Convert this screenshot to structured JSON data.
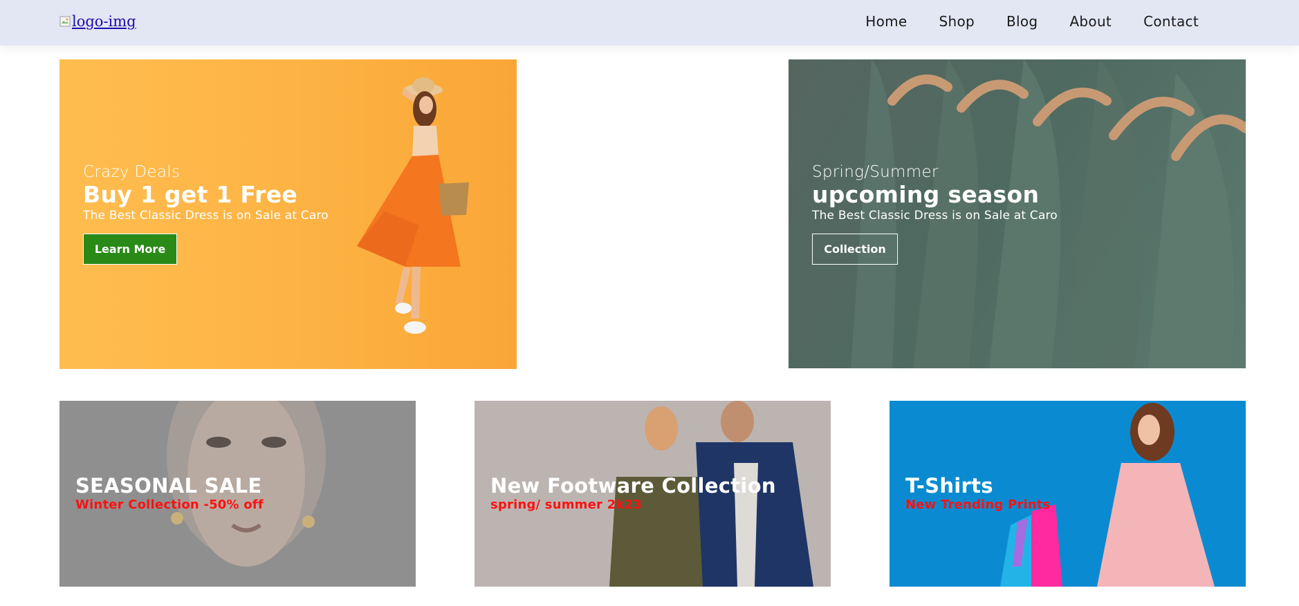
{
  "header": {
    "logo_alt": "logo-img",
    "nav": [
      "Home",
      "Shop",
      "Blog",
      "About",
      "Contact"
    ]
  },
  "banners": [
    {
      "kicker": "Crazy Deals",
      "headline": "Buy 1 get 1 Free",
      "description": "The Best Classic Dress is on Sale at Caro",
      "button": "Learn More"
    },
    {
      "kicker": "Spring/Summer",
      "headline": "upcoming season",
      "description": "The Best Classic Dress is on Sale at Caro",
      "button": "Collection"
    }
  ],
  "cards": [
    {
      "title": "SEASONAL SALE",
      "subtitle": "Winter Collection -50% off"
    },
    {
      "title": "New Footware Collection",
      "subtitle": "spring/ summer 2k23"
    },
    {
      "title": "T-Shirts",
      "subtitle": "New Trending Prints"
    }
  ],
  "colors": {
    "header_bg": "#e3e6f3",
    "learn_button": "#2a8a17",
    "subtitle_red": "#ff1111",
    "banner1_bg": "#fdb444",
    "banner2_bg": "#4f6a61",
    "card3_bg": "#0a8bd1"
  }
}
